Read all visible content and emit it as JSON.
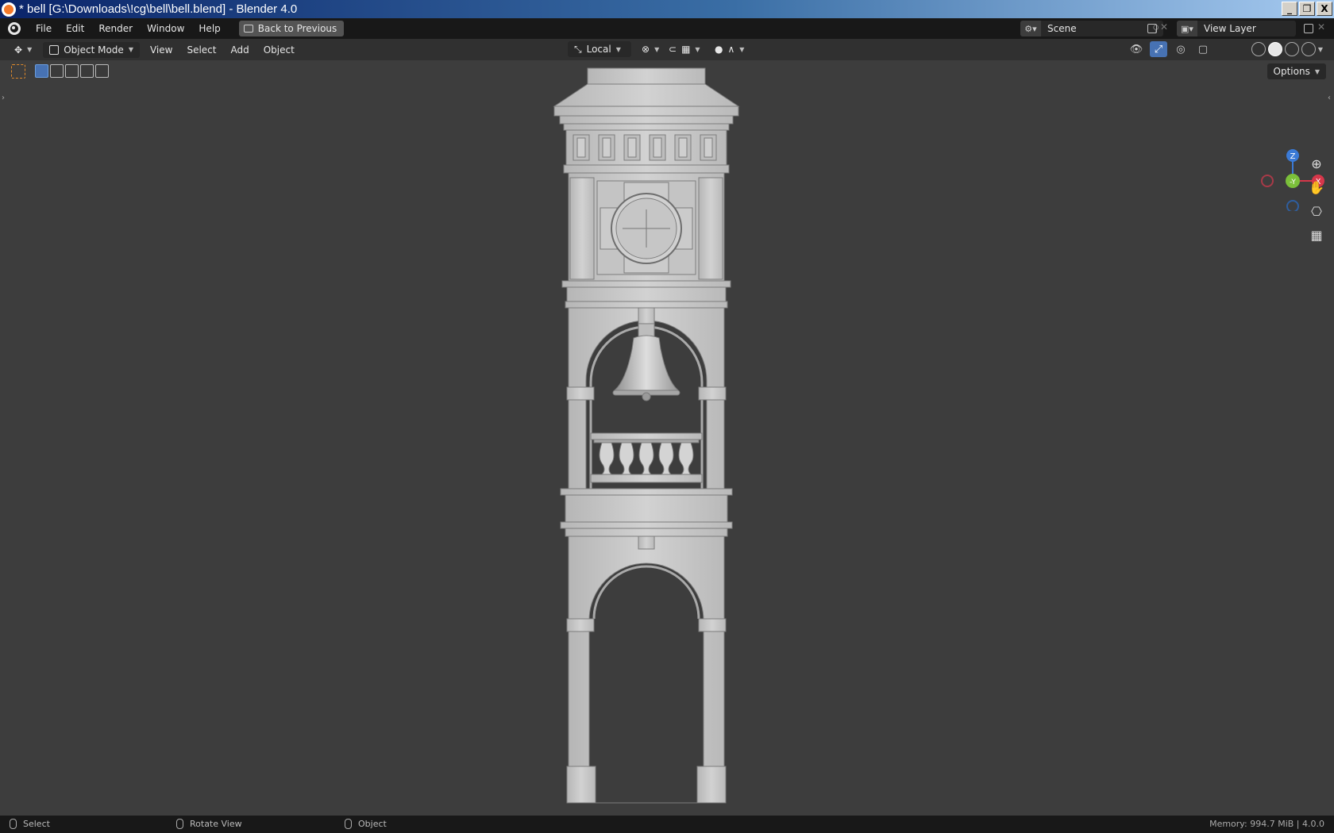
{
  "window": {
    "title": "* bell [G:\\Downloads\\!cg\\bell\\bell.blend] - Blender 4.0",
    "controls": [
      "_",
      "❐",
      "X"
    ]
  },
  "topbar": {
    "menu": [
      "File",
      "Edit",
      "Render",
      "Window",
      "Help"
    ],
    "back_button": "Back to Previous",
    "scene_label": "Scene",
    "view_layer_label": "View Layer"
  },
  "header": {
    "mode": "Object Mode",
    "menus": [
      "View",
      "Select",
      "Add",
      "Object"
    ],
    "transform_orientation": "Local"
  },
  "toolrow": {
    "options": "Options"
  },
  "gizmo": {
    "z": "Z",
    "y": "-Y",
    "x": "X"
  },
  "statusbar": {
    "select": "Select",
    "rotate": "Rotate View",
    "object": "Object",
    "memory": "Memory: 994.7 MiB | 4.0.0"
  },
  "colors": {
    "accent": "#4772b3",
    "x_axis": "#d6374a",
    "y_axis": "#7bc03a",
    "z_axis": "#3b7ad6",
    "model": "#c9c9c9"
  }
}
